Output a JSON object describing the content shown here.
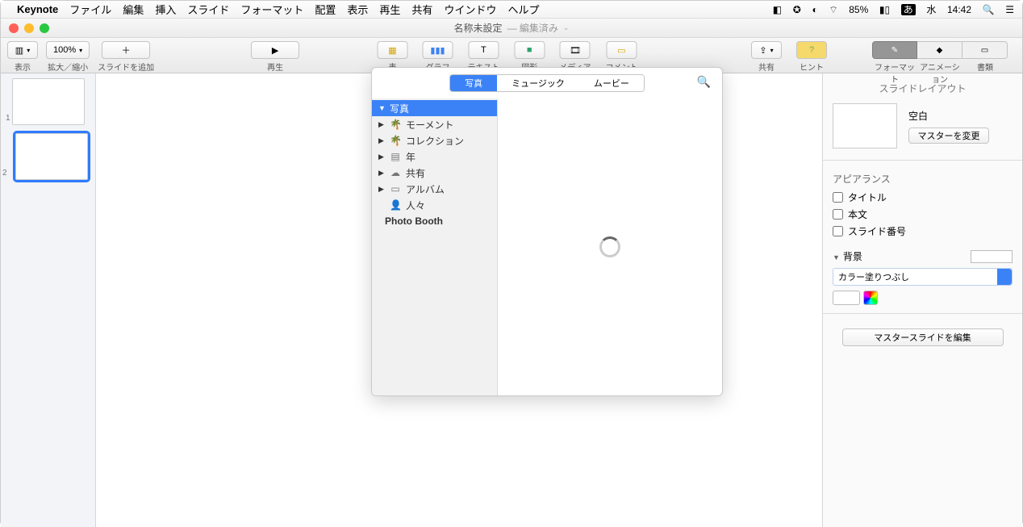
{
  "menubar": {
    "app": "Keynote",
    "items": [
      "ファイル",
      "編集",
      "挿入",
      "スライド",
      "フォーマット",
      "配置",
      "表示",
      "再生",
      "共有",
      "ウインドウ",
      "ヘルプ"
    ],
    "battery": "85%",
    "ime": "あ",
    "day": "水",
    "time": "14:42"
  },
  "title": {
    "doc": "名称未設定",
    "edited": "— 編集済み"
  },
  "toolbar": {
    "view": "表示",
    "zoom_value": "100%",
    "zoom": "拡大／縮小",
    "add_slide": "スライドを追加",
    "play": "再生",
    "table": "表",
    "chart": "グラフ",
    "text": "テキスト",
    "shape": "図形",
    "media": "メディア",
    "comment": "コメント",
    "share": "共有",
    "hint": "ヒント",
    "format": "フォーマット",
    "animation": "アニメーション",
    "document": "書類"
  },
  "slides": {
    "n1": "1",
    "n2": "2"
  },
  "popover": {
    "tab_photo": "写真",
    "tab_music": "ミュージック",
    "tab_movie": "ムービー",
    "side": {
      "photos": "写真",
      "moments": "モーメント",
      "collections": "コレクション",
      "years": "年",
      "shared": "共有",
      "albums": "アルバム",
      "people": "人々",
      "photobooth": "Photo Booth"
    }
  },
  "inspector": {
    "title": "スライドレイアウト",
    "blank": "空白",
    "change_master": "マスターを変更",
    "appearance": "アピアランス",
    "chk_title": "タイトル",
    "chk_body": "本文",
    "chk_number": "スライド番号",
    "background": "背景",
    "fill_mode": "カラー塗りつぶし",
    "edit_master": "マスタースライドを編集"
  }
}
